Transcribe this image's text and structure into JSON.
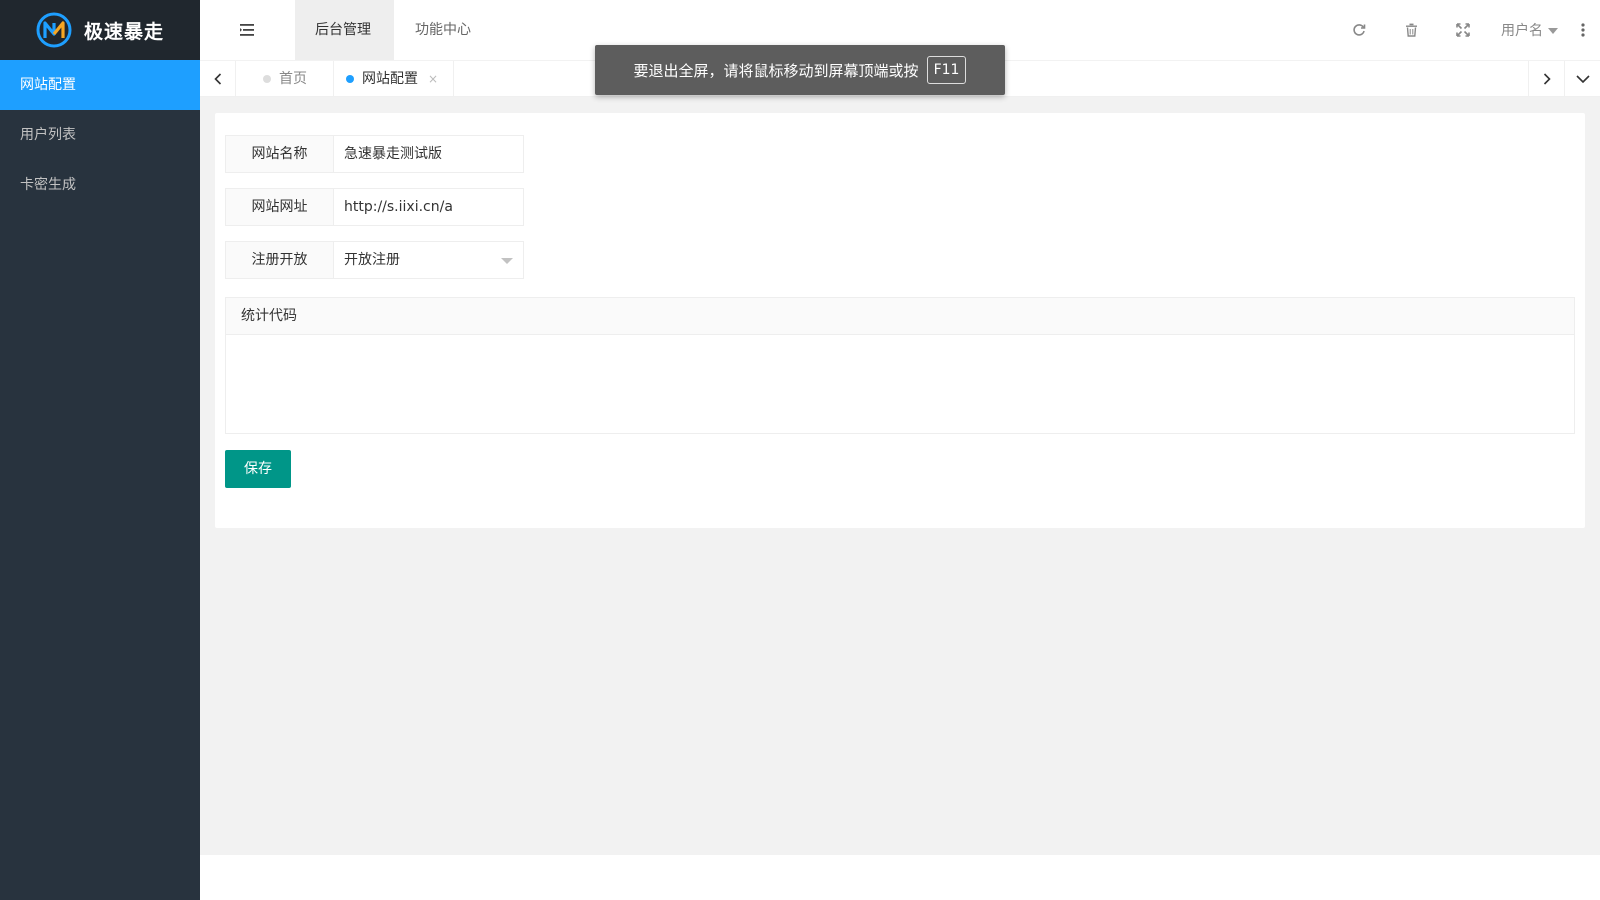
{
  "brand": {
    "name": "极速暴走",
    "logo_icon": "brand-logo-icon"
  },
  "sidebar": {
    "items": [
      {
        "label": "网站配置",
        "active": true
      },
      {
        "label": "用户列表",
        "active": false
      },
      {
        "label": "卡密生成",
        "active": false
      }
    ]
  },
  "header": {
    "tabs": [
      {
        "label": "后台管理",
        "active": true
      },
      {
        "label": "功能中心",
        "active": false
      }
    ],
    "user_label": "用户名",
    "icons": [
      "menu-toggle-icon",
      "refresh-icon",
      "trash-icon",
      "fullscreen-icon",
      "more-icon"
    ]
  },
  "pagetabs": {
    "tabs": [
      {
        "label": "首页",
        "active": false
      },
      {
        "label": "网站配置",
        "active": true,
        "close": "×"
      }
    ]
  },
  "toast": {
    "message": "要退出全屏，请将鼠标移动到屏幕顶端或按",
    "key": "F11"
  },
  "form": {
    "site_name": {
      "label": "网站名称",
      "value": "急速暴走测试版"
    },
    "site_url": {
      "label": "网站网址",
      "value": "http://s.iixi.cn/a"
    },
    "register": {
      "label": "注册开放",
      "value": "开放注册"
    },
    "stats_code": {
      "label": "统计代码",
      "value": ""
    },
    "save_label": "保存"
  },
  "colors": {
    "sidebar": "#28333e",
    "active_blue": "#1e9fff",
    "save_green": "#009688"
  }
}
